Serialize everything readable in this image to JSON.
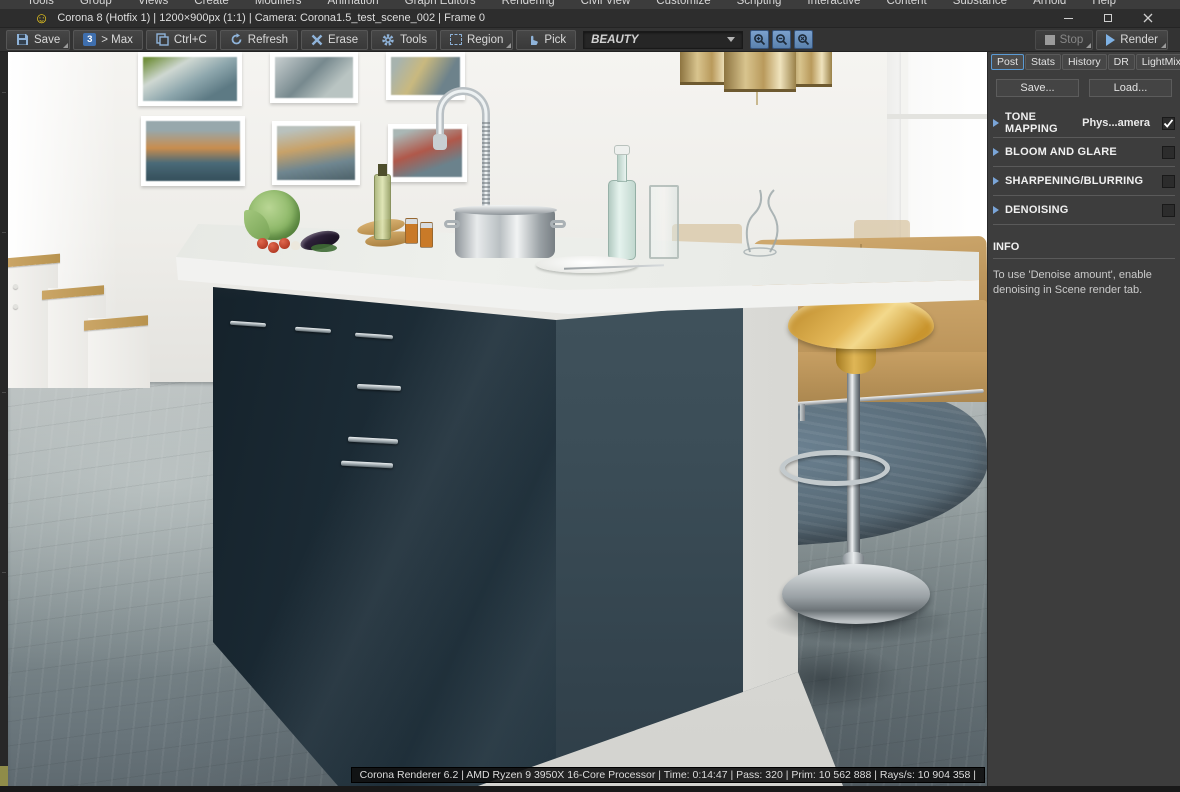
{
  "menubar": {
    "items": [
      "Tools",
      "Group",
      "Views",
      "Create",
      "Modifiers",
      "Animation",
      "Graph Editors",
      "Rendering",
      "Civil View",
      "Customize",
      "Scripting",
      "Interactive",
      "Content",
      "Substance",
      "Arnold",
      "Help"
    ]
  },
  "titlebar": {
    "title": "Corona 8 (Hotfix 1) | 1200×900px (1:1) | Camera: Corona1.5_test_scene_002 | Frame 0",
    "smiley_icon": "☺"
  },
  "toolbar": {
    "save": "Save",
    "max_label": "> Max",
    "max_badge": "3",
    "copy": "Ctrl+C",
    "refresh": "Refresh",
    "erase": "Erase",
    "tools": "Tools",
    "region": "Region",
    "pick": "Pick",
    "channel": "BEAUTY",
    "stop": "Stop",
    "render": "Render"
  },
  "panel": {
    "tabs": [
      "Post",
      "Stats",
      "History",
      "DR",
      "LightMix"
    ],
    "active_tab": "Post",
    "save_button": "Save...",
    "load_button": "Load...",
    "sections": [
      {
        "label": "TONE MAPPING",
        "extra": "Phys...amera",
        "checked": true
      },
      {
        "label": "BLOOM AND GLARE",
        "extra": "",
        "checked": false
      },
      {
        "label": "SHARPENING/BLURRING",
        "extra": "",
        "checked": false
      },
      {
        "label": "DENOISING",
        "extra": "",
        "checked": false
      }
    ],
    "info_header": "INFO",
    "info_text": "To use 'Denoise amount', enable denoising in Scene render tab."
  },
  "statusbar": {
    "text": "Corona Renderer 6.2 | AMD Ryzen 9 3950X 16-Core Processor  | Time: 0:14:47 | Pass: 320 | Prim: 10 562 888 | Rays/s: 10 904 358 |"
  },
  "render_view": {
    "scene_description": "Corona render: kitchen island with dark glossy cabinets and white countertop, chrome faucet and pot, glass bottle, vegetables, framed wall art, brass pendant lamp, tan leather sofa, amber bar stool on chrome base, gray concrete floor with blue-gray rug"
  },
  "colors": {
    "accent_blue": "#5b9bd5",
    "icon_blue": "#8fb3d9",
    "panel_bg": "#3d3d3d",
    "titlebar_bg": "#2d2d2d",
    "smiley_yellow": "#f2cf1d",
    "render_play": "#7fb2e5",
    "cabinet_dark": "#1d2b34",
    "stool_amber": "#d8a93f",
    "sofa_tan": "#c3a068"
  }
}
